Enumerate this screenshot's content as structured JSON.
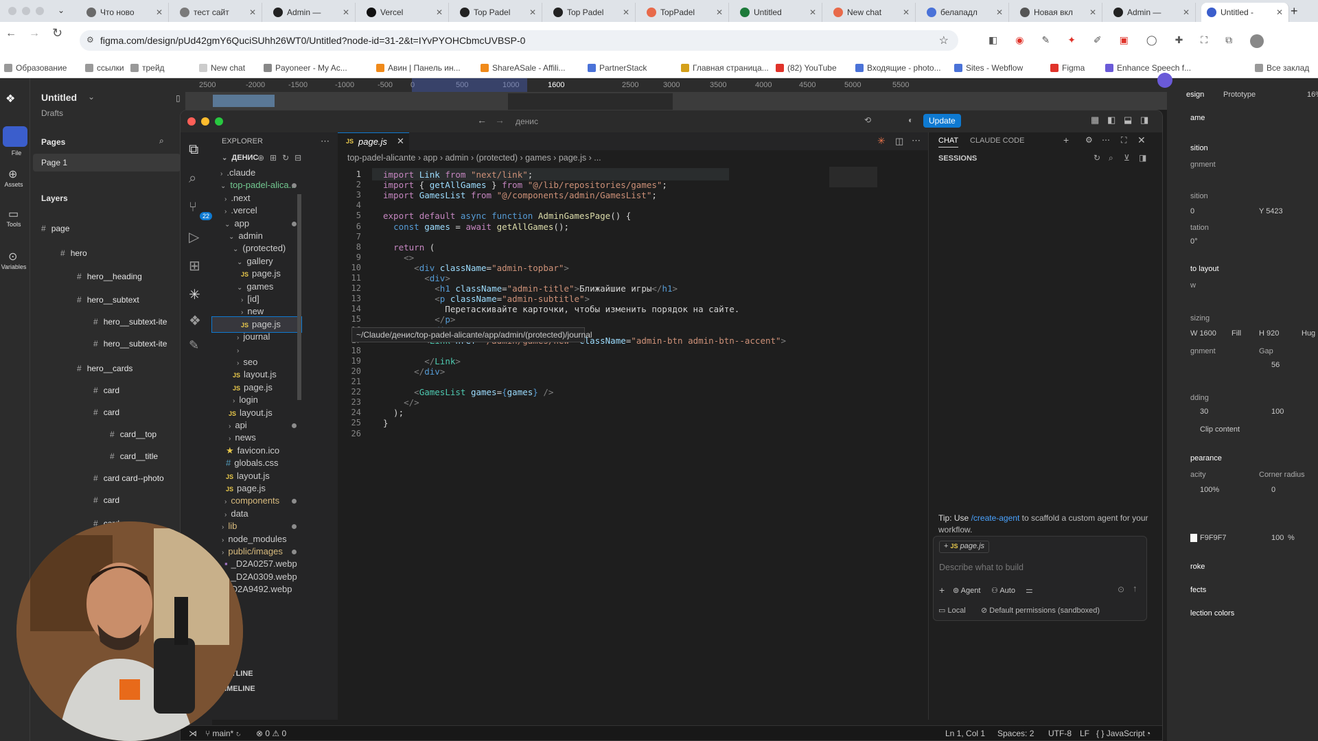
{
  "browser": {
    "tabs": [
      {
        "title": "Что ново"
      },
      {
        "title": "тест сайт"
      },
      {
        "title": "Admin — "
      },
      {
        "title": "Vercel"
      },
      {
        "title": "Top Padel"
      },
      {
        "title": "Top Padel"
      },
      {
        "title": "TopPadel"
      },
      {
        "title": "Untitled"
      },
      {
        "title": "New chat"
      },
      {
        "title": "белападл"
      },
      {
        "title": "Новая вкл"
      },
      {
        "title": "Admin — "
      },
      {
        "title": "Untitled -"
      }
    ],
    "url": "figma.com/design/pUd42gmY6QuciSUhh26WT0/Untitled?node-id=31-2&t=IYvPYOHCbmcUVBSP-0",
    "bookmarks": [
      "Образование",
      "ссылки",
      "трейд",
      "New chat",
      "Payoneer - My Ac...",
      "Авин | Панель ин...",
      "ShareASale - Affili...",
      "PartnerStack",
      "Главная страница...",
      "(82) YouTube",
      "Входящие - photo...",
      "Sites - Webflow",
      "Figma",
      "Enhance Speech f...",
      "Все заклад"
    ]
  },
  "figma": {
    "file_title": "Untitled",
    "drafts": "Drafts",
    "pages_label": "Pages",
    "page_item": "Page 1",
    "layers_label": "Layers",
    "strip": [
      "File",
      "Assets",
      "Tools",
      "Variables"
    ],
    "layers": [
      "page",
      "hero",
      "hero__heading",
      "hero__subtext",
      "hero__subtext-ite",
      "hero__subtext-ite",
      "hero__cards",
      "card",
      "card",
      "card__top",
      "card__title",
      "card card--photo",
      "card",
      "card"
    ],
    "ruler": [
      "2500",
      "-2000",
      "-1500",
      "-1000",
      "-500",
      "0",
      "500",
      "1000",
      "1600",
      "2500",
      "3000",
      "3500",
      "4000",
      "4500",
      "5000",
      "5500"
    ],
    "right": {
      "tabs": [
        "esign",
        "Prototype",
        "16%"
      ],
      "frame": "ame",
      "position": "sition",
      "alignment": "gnment",
      "position2": "sition",
      "x_val": "0",
      "y_val": "Y 5423",
      "rotation": "tation",
      "rot_val": "0°",
      "autolayout": "to layout",
      "flow": "w",
      "sizing": "sizing",
      "w": "W 1600",
      "fill": "Fill",
      "h": "H 920",
      "hug": "Hug",
      "align2": "gnment",
      "gap": "Gap",
      "gap_val": "56",
      "padding": "dding",
      "pad1": "30",
      "pad2": "100",
      "clip": "Clip content",
      "appearance": "pearance",
      "opacity": "acity",
      "radius": "Corner radius",
      "op_val": "100%",
      "rad_val": "0",
      "fill_hex": "F9F9F7",
      "fill_pct": "100",
      "pct": "%",
      "stroke": "roke",
      "effects": "fects",
      "selection": "lection colors"
    }
  },
  "vscode": {
    "search": "денис",
    "update": "Update",
    "explorer": "EXPLORER",
    "root": "ДЕНИС",
    "tree": [
      {
        "name": ".claude",
        "type": "dir"
      },
      {
        "name": "top-padel-alica...",
        "type": "dir"
      },
      {
        "name": ".next",
        "type": "dir"
      },
      {
        "name": ".vercel",
        "type": "dir"
      },
      {
        "name": "app",
        "type": "dir"
      },
      {
        "name": "admin",
        "type": "dir"
      },
      {
        "name": "(protected)",
        "type": "dir"
      },
      {
        "name": "gallery",
        "type": "dir"
      },
      {
        "name": "page.js",
        "type": "js"
      },
      {
        "name": "games",
        "type": "dir"
      },
      {
        "name": "[id]",
        "type": "dir"
      },
      {
        "name": "new",
        "type": "dir"
      },
      {
        "name": "page.js",
        "type": "js"
      },
      {
        "name": "journal",
        "type": "dir"
      },
      {
        "name": "",
        "type": "dir"
      },
      {
        "name": "seo",
        "type": "dir"
      },
      {
        "name": "layout.js",
        "type": "js"
      },
      {
        "name": "page.js",
        "type": "js"
      },
      {
        "name": "login",
        "type": "dir"
      },
      {
        "name": "layout.js",
        "type": "js"
      },
      {
        "name": "api",
        "type": "dir"
      },
      {
        "name": "news",
        "type": "dir"
      },
      {
        "name": "favicon.ico",
        "type": "ico"
      },
      {
        "name": "globals.css",
        "type": "css"
      },
      {
        "name": "layout.js",
        "type": "js"
      },
      {
        "name": "page.js",
        "type": "js"
      },
      {
        "name": "components",
        "type": "dir"
      },
      {
        "name": "data",
        "type": "dir"
      },
      {
        "name": "lib",
        "type": "dir"
      },
      {
        "name": "node_modules",
        "type": "dir"
      },
      {
        "name": "public/images",
        "type": "dir"
      },
      {
        "name": "_D2A0257.webp",
        "type": "img"
      },
      {
        "name": "_D2A0309.webp",
        "type": "img"
      },
      {
        "name": "D2A9492.webp",
        "type": "img"
      }
    ],
    "tooltip": "~/Claude/денис/top-padel-alicante/app/admin/(protected)/journal",
    "outline": "OUTLINE",
    "timeline": "TIMELINE",
    "tab": "page.js",
    "breadcrumb": [
      "top-padel-alicante",
      "app",
      "admin",
      "(protected)",
      "games",
      "page.js",
      "..."
    ],
    "chat_tabs": [
      "CHAT",
      "CLAUDE CODE"
    ],
    "sessions": "SESSIONS",
    "tip_prefix": "Tip: Use",
    "tip_link": "/create-agent",
    "tip_suffix": "to scaffold a custom agent for your workflow.",
    "context_file": "page.js",
    "chat_placeholder": "Describe what to build",
    "agent": "Agent",
    "auto": "Auto",
    "local": "Local",
    "permissions": "Default permissions (sandboxed)",
    "status": {
      "branch": "main*",
      "errors": "0",
      "warnings": "0",
      "pos": "Ln 1, Col 1",
      "spaces": "Spaces: 2",
      "enc": "UTF-8",
      "eol": "LF",
      "lang": "JavaScript"
    }
  }
}
